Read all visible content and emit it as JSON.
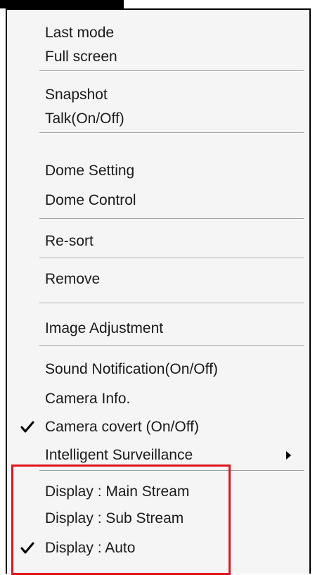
{
  "menu": {
    "items": [
      {
        "label": "Last mode"
      },
      {
        "label": "Full screen"
      },
      {
        "label": "Snapshot"
      },
      {
        "label": "Talk(On/Off)"
      },
      {
        "label": "Dome Setting"
      },
      {
        "label": "Dome Control"
      },
      {
        "label": "Re-sort"
      },
      {
        "label": "Remove"
      },
      {
        "label": "Image Adjustment"
      },
      {
        "label": "Sound Notification(On/Off)"
      },
      {
        "label": "Camera Info."
      },
      {
        "label": "Camera covert (On/Off)",
        "checked": true
      },
      {
        "label": "Intelligent Surveillance",
        "has_submenu": true
      },
      {
        "label": "Display : Main Stream"
      },
      {
        "label": "Display : Sub Stream"
      },
      {
        "label": "Display : Auto",
        "checked": true
      }
    ]
  },
  "colors": {
    "highlight_border": "#e0141e",
    "menu_background": "#f5f5f5"
  }
}
